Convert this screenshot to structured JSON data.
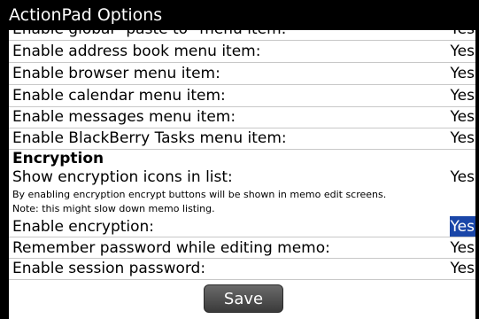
{
  "window": {
    "title": "ActionPad Options"
  },
  "rows_top": [
    {
      "label": "Enable global \"paste to\" menu item:",
      "value": "Yes"
    },
    {
      "label": "Enable address book menu item:",
      "value": "Yes"
    },
    {
      "label": "Enable browser menu item:",
      "value": "Yes"
    },
    {
      "label": "Enable calendar menu item:",
      "value": "Yes"
    },
    {
      "label": "Enable messages menu item:",
      "value": "Yes"
    },
    {
      "label": "Enable BlackBerry Tasks menu item:",
      "value": "Yes"
    }
  ],
  "encryption": {
    "title": "Encryption",
    "show_icons": {
      "label": "Show encryption icons in list:",
      "value": "Yes"
    },
    "note_line1": "By enabling encryption encrypt buttons will be shown in memo edit screens.",
    "note_line2": "Note: this might slow down memo listing.",
    "enable": {
      "label": "Enable encryption:",
      "value": "Yes"
    },
    "remember": {
      "label": "Remember password while editing memo:",
      "value": "Yes"
    },
    "session": {
      "label": "Enable session password:",
      "value": "Yes"
    }
  },
  "save_label": "Save",
  "colors": {
    "selection": "#1a46a8",
    "title_bar": "#000000"
  }
}
